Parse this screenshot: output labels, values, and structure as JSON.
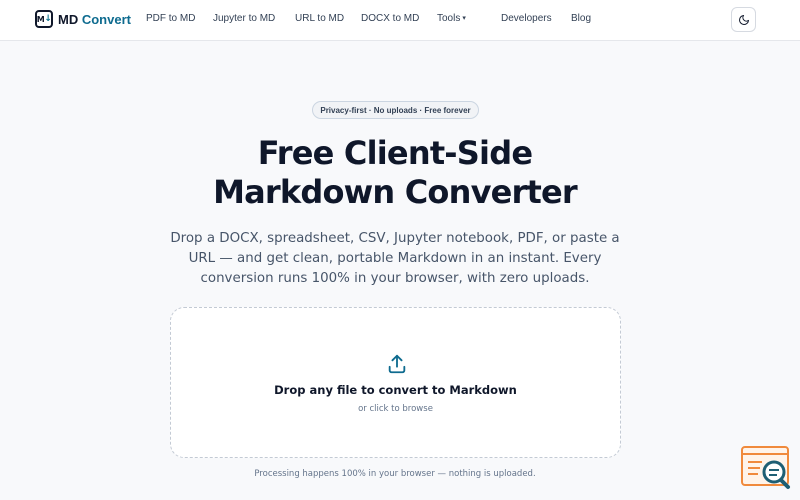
{
  "nav": {
    "logo": {
      "mark_text": "M",
      "mark_arrow": "↓",
      "text_main": "MD",
      "text_accent": "Convert"
    },
    "links": [
      {
        "label": "PDF to MD"
      },
      {
        "label": "Jupyter to MD"
      },
      {
        "label": "URL to MD"
      },
      {
        "label": "DOCX to MD"
      },
      {
        "label": "Tools",
        "caret": "▾"
      },
      {
        "label": "Developers"
      },
      {
        "label": "Blog"
      }
    ],
    "theme_toggle_icon": "moon-icon"
  },
  "hero": {
    "badge": "Privacy-first · No uploads · Free forever",
    "title_line1": "Free Client-Side",
    "title_line2": "Markdown Converter",
    "subtitle": "Drop a DOCX, spreadsheet, CSV, Jupyter notebook, PDF, or paste a URL — and get clean, portable Markdown in an instant. Every conversion runs 100% in your browser, with zero uploads."
  },
  "dropzone": {
    "icon": "upload-icon",
    "title": "Drop any file to convert to Markdown",
    "subtitle": "or click to browse"
  },
  "footnote": "Processing happens 100% in your browser — nothing is uploaded.",
  "colors": {
    "accent": "#0e6b8f",
    "widget_orange": "#f08a3c",
    "widget_teal": "#1e5f74"
  }
}
